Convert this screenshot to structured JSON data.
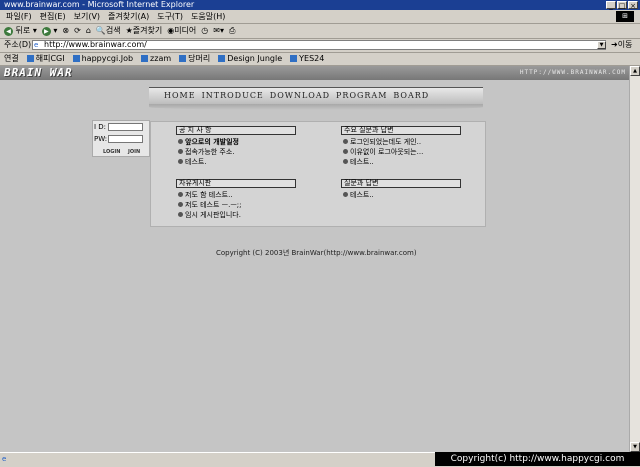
{
  "window": {
    "title": "www.brainwar.com - Microsoft Internet Explorer"
  },
  "menu": [
    "파일(F)",
    "편집(E)",
    "보기(V)",
    "즐겨찾기(A)",
    "도구(T)",
    "도움말(H)"
  ],
  "toolbar": {
    "back": "뒤로",
    "search": "검색",
    "favorites": "즐겨찾기",
    "media": "미디어"
  },
  "address": {
    "label": "주소(D)",
    "url": "http://www.brainwar.com/",
    "go": "이동"
  },
  "links": {
    "label": "연결",
    "items": [
      "해피CGI",
      "happycgi.Job",
      "zzam",
      "당머리",
      "Design Jungle",
      "YES24"
    ]
  },
  "site": {
    "logo": "BRAIN WAR",
    "url": "HTTP://WWW.BRAINWAR.COM",
    "nav": [
      "HOME",
      "INTRODUCE",
      "DOWNLOAD",
      "PROGRAM",
      "BOARD"
    ],
    "login": {
      "id_label": "I D:",
      "pw_label": "PW:",
      "login_button": "LOGIN",
      "join_button": "JOIN"
    },
    "notice": {
      "title": "공 지 사 항",
      "items": [
        "앞으로의 개발일정",
        "접속가능한 주소.",
        "테스트."
      ]
    },
    "faq": {
      "title": "주요 질문과 답변",
      "items": [
        "로그인되었는데도 게인..",
        "이유없이 로그아웃되는...",
        "테스트.."
      ]
    },
    "free": {
      "title": "자유게시판",
      "items": [
        "저도 함 테스트..",
        "저도 테스트 ㅡ.ㅡ;;",
        "임시 게시판입니다."
      ]
    },
    "qna": {
      "title": "질문과 답변",
      "items": [
        "테스트.."
      ]
    },
    "copyright": "Copyright (C) 2003년 BrainWar(http://www.brainwar.com)"
  },
  "watermark": "Copyright(c) http://www.happycgi.com"
}
